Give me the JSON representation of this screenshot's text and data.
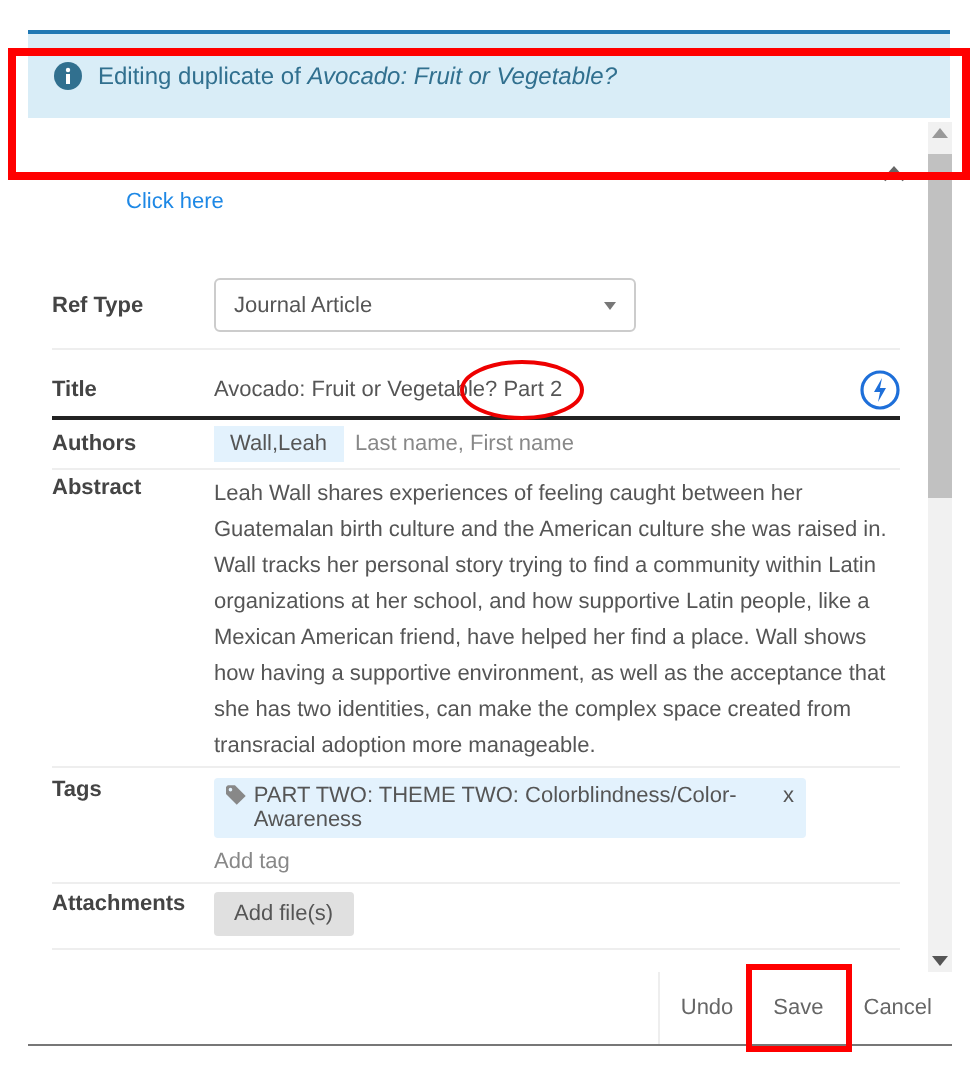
{
  "banner": {
    "message": "Editing duplicate of *Avocado: Fruit or Vegetable?*",
    "highlighted": true
  },
  "link": "Click here",
  "fields": [
    {
      "kind": "select",
      "label": "Ref Type",
      "value": "Journal Article"
    },
    {
      "kind": "title",
      "label": "Title",
      "value": "Avocado: Fruit or Vegetable? Part 2",
      "circled": true
    },
    {
      "kind": "authors",
      "label": "Authors",
      "chips": [
        "Wall,Leah"
      ],
      "placeholder": "Last name, First name"
    },
    {
      "kind": "text",
      "label": "Abstract",
      "value": "Leah Wall shares experiences of feeling caught between her Guatemalan birth culture and the American culture she was raised in. Wall tracks her personal story trying to find a community within Latin organizations at her school, and how supportive Latin people, like a Mexican American friend, have helped her find a place. Wall shows how having a supportive environment, as well as the acceptance that she has two identities, can make the complex space created from transracial adoption more manageable."
    },
    {
      "kind": "tags",
      "label": "Tags",
      "tags": [
        {
          "text": "PART TWO: THEME TWO: Colorblindness/Color-Awareness",
          "remove": "x"
        }
      ],
      "placeholder": "Add tag"
    },
    {
      "kind": "attachments",
      "label": "Attachments",
      "button": "Add file(s)"
    }
  ],
  "footer": {
    "buttons": [
      {
        "label": "Undo",
        "highlighted": false
      },
      {
        "label": "Save",
        "highlighted": true
      },
      {
        "label": "Cancel",
        "highlighted": false
      }
    ]
  }
}
